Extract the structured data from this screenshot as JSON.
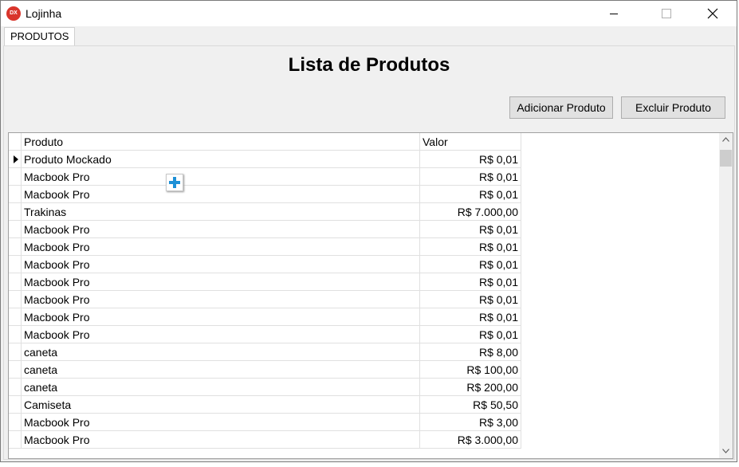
{
  "window": {
    "title": "Lojinha",
    "app_icon_text": "DX",
    "icon_color": "#d9352b"
  },
  "tabs": [
    {
      "label": "PRODUTOS"
    }
  ],
  "main": {
    "title": "Lista de Produtos",
    "add_button": "Adicionar Produto",
    "delete_button": "Excluir Produto"
  },
  "grid": {
    "columns": [
      "Produto",
      "Valor"
    ],
    "rows": [
      {
        "produto": "Produto Mockado",
        "valor": "R$ 0,01"
      },
      {
        "produto": "Macbook Pro",
        "valor": "R$ 0,01"
      },
      {
        "produto": "Macbook Pro",
        "valor": "R$ 0,01"
      },
      {
        "produto": "Trakinas",
        "valor": "R$ 7.000,00"
      },
      {
        "produto": "Macbook Pro",
        "valor": "R$ 0,01"
      },
      {
        "produto": "Macbook Pro",
        "valor": "R$ 0,01"
      },
      {
        "produto": "Macbook Pro",
        "valor": "R$ 0,01"
      },
      {
        "produto": "Macbook Pro",
        "valor": "R$ 0,01"
      },
      {
        "produto": "Macbook Pro",
        "valor": "R$ 0,01"
      },
      {
        "produto": "Macbook Pro",
        "valor": "R$ 0,01"
      },
      {
        "produto": "Macbook Pro",
        "valor": "R$ 0,01"
      },
      {
        "produto": "caneta",
        "valor": "R$ 8,00"
      },
      {
        "produto": "caneta",
        "valor": "R$ 100,00"
      },
      {
        "produto": "caneta",
        "valor": "R$ 200,00"
      },
      {
        "produto": "Camiseta",
        "valor": "R$ 50,50"
      },
      {
        "produto": "Macbook Pro",
        "valor": "R$ 3,00"
      },
      {
        "produto": "Macbook Pro",
        "valor": "R$ 3.000,00"
      }
    ],
    "current_row_index": 0
  },
  "icons": {
    "app": "app-icon",
    "minimize": "minimize-icon",
    "maximize": "maximize-icon",
    "close": "close-icon",
    "row_pointer": "row-pointer-icon",
    "drag_add": "plus-icon",
    "scroll_up": "chevron-up-icon",
    "scroll_down": "chevron-down-icon"
  },
  "colors": {
    "accent_plus": "#1e90d6"
  }
}
